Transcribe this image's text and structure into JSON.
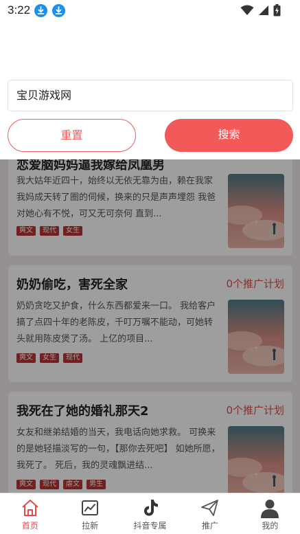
{
  "status_bar": {
    "time": "3:22"
  },
  "search": {
    "value": "宝贝游戏网",
    "reset_label": "重置",
    "search_label": "搜索"
  },
  "cards": [
    {
      "title": "恋爱脑妈妈逼我嫁给凤凰男",
      "plan": "",
      "desc": "我大姑年近四十，始终以无依无靠为由，赖在我家 我妈成天转了圈的伺候，换来的只是声声埋怨 我爸对她心有不悦，可又无可奈何 直到...",
      "tags": [
        "爽文",
        "现代",
        "女生"
      ]
    },
    {
      "title": "奶奶偷吃，害死全家",
      "plan": "0个推广计划",
      "desc": "奶奶贪吃又护食，什么东西都爱来一口。 我给客户搞了点四十年的老陈皮，千叮万嘱不能动，可她转头就用陈皮煲了汤。 上亿的项目...",
      "tags": [
        "爽文",
        "女生",
        "现代"
      ]
    },
    {
      "title": "我死在了她的婚礼那天2",
      "plan": "0个推广计划",
      "desc": "女友和继弟结婚的当天，我电话向她求救。 可换来的是她轻描淡写的一句，【那你去死吧】 如她所愿，我死了。 死后，我的灵魂飘进结...",
      "tags": [
        "爽文",
        "现代",
        "虐文",
        "男生"
      ]
    }
  ],
  "nav": [
    {
      "label": "首页",
      "icon": "home-icon",
      "active": true
    },
    {
      "label": "拉新",
      "icon": "chart-icon",
      "active": false
    },
    {
      "label": "抖音专属",
      "icon": "tiktok-icon",
      "active": false
    },
    {
      "label": "推广",
      "icon": "send-icon",
      "active": false
    },
    {
      "label": "我的",
      "icon": "user-icon",
      "active": false
    }
  ],
  "colors": {
    "accent": "#f25a5a",
    "tag": "#b83232",
    "plan": "#e24a4a"
  }
}
